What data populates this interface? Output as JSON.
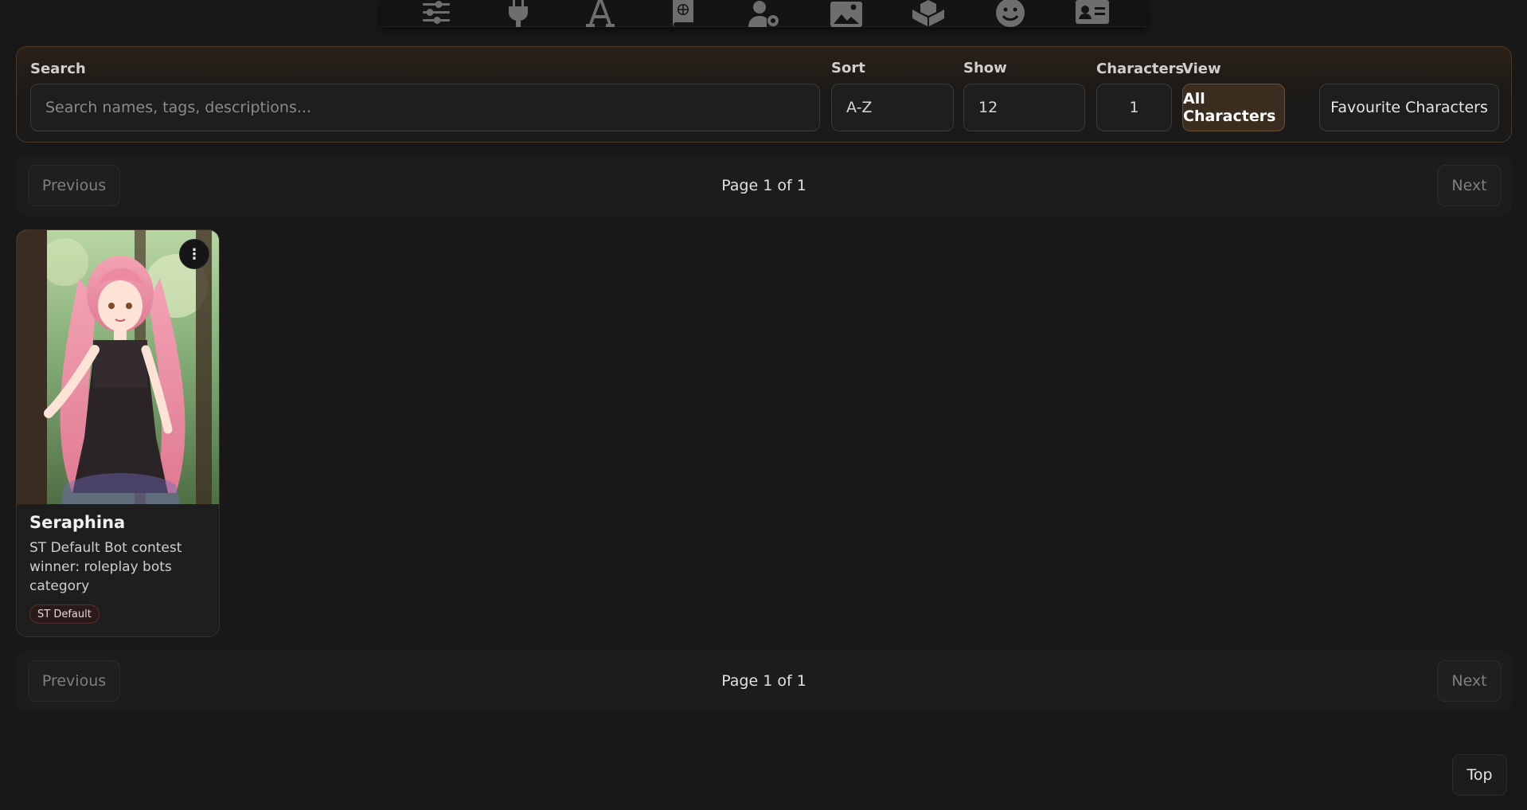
{
  "toolbar": {
    "icons": [
      "sliders-icon",
      "plug-icon",
      "font-icon",
      "book-globe-icon",
      "user-gear-icon",
      "image-icon",
      "cubes-icon",
      "smile-icon",
      "id-card-icon"
    ]
  },
  "filters": {
    "search_label": "Search",
    "search_placeholder": "Search names, tags, descriptions...",
    "search_value": "",
    "sort_label": "Sort",
    "sort_value": "A-Z",
    "show_label": "Show",
    "show_value": "12",
    "characters_label": "Characters",
    "characters_value": "1",
    "view_label": "View",
    "view_all": "All Characters",
    "view_favourite": "Favourite Characters",
    "active_view": "All Characters"
  },
  "pagination": {
    "previous": "Previous",
    "next": "Next",
    "page_text": "Page 1 of 1"
  },
  "characters": [
    {
      "name": "Seraphina",
      "description": "ST Default Bot contest winner: roleplay bots category",
      "tags": [
        "ST Default"
      ],
      "menu_glyph": "⋮"
    }
  ],
  "footer": {
    "top_label": "Top"
  },
  "colors": {
    "background": "#181818",
    "accent_border": "#4a3a24",
    "active_view_bg": "#3a2c1e"
  }
}
